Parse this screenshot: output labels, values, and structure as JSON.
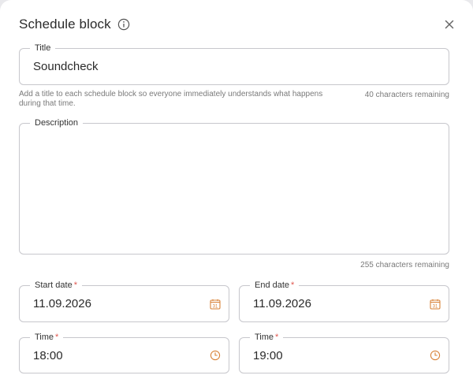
{
  "dialog": {
    "title": "Schedule block"
  },
  "title_field": {
    "label": "Title",
    "value": "Soundcheck",
    "helper": "Add a title to each schedule block so everyone immediately understands what happens during that time.",
    "counter": "40 characters remaining"
  },
  "description_field": {
    "label": "Description",
    "value": "",
    "counter": "255 characters remaining"
  },
  "start_date": {
    "label": "Start date",
    "required_mark": "*",
    "value": "11.09.2026"
  },
  "end_date": {
    "label": "End date",
    "required_mark": "*",
    "value": "11.09.2026"
  },
  "start_time": {
    "label": "Time",
    "required_mark": "*",
    "value": "18:00"
  },
  "end_time": {
    "label": "Time",
    "required_mark": "*",
    "value": "19:00"
  },
  "calendar_icon_day": "31",
  "icons": {
    "info": "info-icon",
    "close": "close-icon",
    "calendar": "calendar-icon",
    "clock": "clock-icon"
  },
  "colors": {
    "accent_icon": "#d9843a",
    "required": "#e0574f",
    "border": "#c7c7cc"
  }
}
